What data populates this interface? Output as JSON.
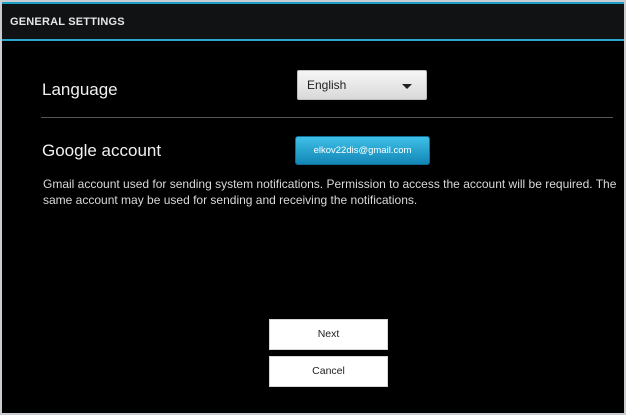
{
  "header": {
    "title": "GENERAL SETTINGS"
  },
  "language": {
    "label": "Language",
    "selected": "English"
  },
  "google_account": {
    "label": "Google account",
    "value": "elkov22dis@gmail.com",
    "description": "Gmail account used for sending system notifications. Permission to access the account will be required. The same account may be used for sending and receiving the notifications."
  },
  "actions": {
    "next_label": "Next",
    "cancel_label": "Cancel"
  },
  "colors": {
    "accent": "#2ba8cf",
    "background": "#000000",
    "account_button": "#1e9ec4"
  }
}
